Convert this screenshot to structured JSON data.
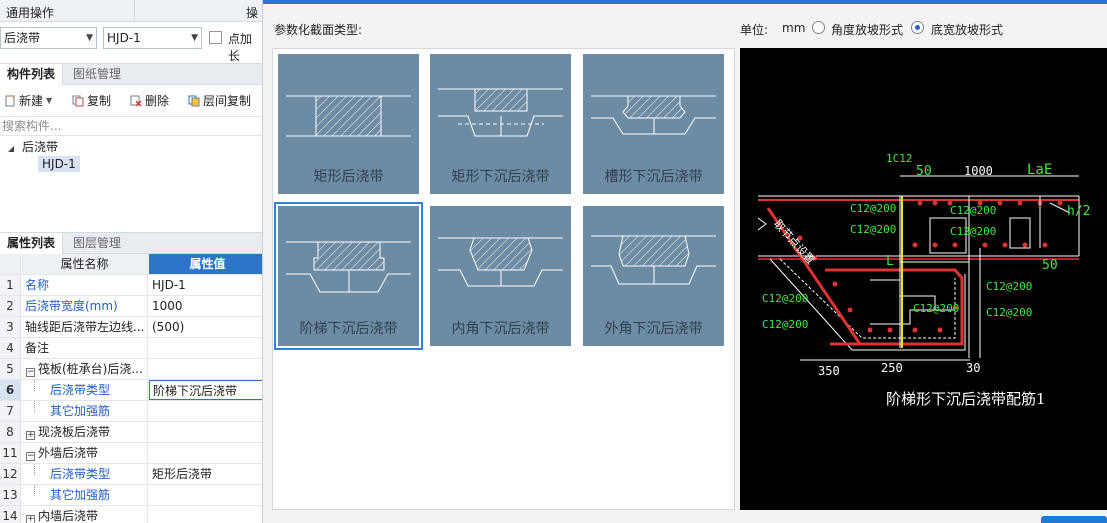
{
  "left": {
    "topbar": {
      "title": "通用操作",
      "title2": "操"
    },
    "combo1": {
      "value": "后浇带"
    },
    "combo2": {
      "value": "HJD-1"
    },
    "checkbox_label": "点加长",
    "tabs1": [
      "构件列表",
      "图纸管理"
    ],
    "toolbar": {
      "new": "新建",
      "copy": "复制",
      "delete": "删除",
      "floor_copy": "层间复制"
    },
    "search_placeholder": "搜索构件...",
    "tree": {
      "root": "后浇带",
      "child": "HJD-1"
    },
    "tabs2": [
      "属性列表",
      "图层管理"
    ],
    "grid": {
      "header": {
        "name": "属性名称",
        "value": "属性值"
      },
      "rows": [
        {
          "num": "1",
          "name": "名称",
          "value": "HJD-1",
          "blue": true
        },
        {
          "num": "2",
          "name": "后浇带宽度(mm)",
          "value": "1000",
          "blue": true
        },
        {
          "num": "3",
          "name": "轴线距后浇带左边线...",
          "value": "(500)"
        },
        {
          "num": "4",
          "name": "备注",
          "value": ""
        },
        {
          "num": "5",
          "name": "筏板(桩承台)后浇...",
          "value": "",
          "exp": "−"
        },
        {
          "num": "6",
          "name": "后浇带类型",
          "value": "阶梯下沉后浇带",
          "blue": true,
          "indent": true,
          "selected": true
        },
        {
          "num": "7",
          "name": "其它加强筋",
          "value": "",
          "blue": true,
          "indent": true
        },
        {
          "num": "8",
          "name": "现浇板后浇带",
          "value": "",
          "exp": "+"
        },
        {
          "num": "11",
          "name": "外墙后浇带",
          "value": "",
          "exp": "−"
        },
        {
          "num": "12",
          "name": "后浇带类型",
          "value": "矩形后浇带",
          "blue": true,
          "indent": true
        },
        {
          "num": "13",
          "name": "其它加强筋",
          "value": "",
          "blue": true,
          "indent": true
        },
        {
          "num": "14",
          "name": "内墙后浇带",
          "value": "",
          "exp": "+"
        }
      ]
    }
  },
  "dialog": {
    "type_label": "参数化截面类型:",
    "unit_label": "单位:",
    "unit_value": "mm",
    "radio1": "角度放坡形式",
    "radio2": "底宽放坡形式",
    "cards": [
      {
        "label": "矩形后浇带",
        "kind": "rect"
      },
      {
        "label": "矩形下沉后浇带",
        "kind": "rect-sink"
      },
      {
        "label": "槽形下沉后浇带",
        "kind": "slot-sink"
      },
      {
        "label": "阶梯下沉后浇带",
        "kind": "step-sink",
        "selected": true
      },
      {
        "label": "内角下沉后浇带",
        "kind": "inner-sink"
      },
      {
        "label": "外角下沉后浇带",
        "kind": "outer-sink"
      }
    ],
    "preview": {
      "caption": "阶梯形下沉后浇带配筋1",
      "labels": {
        "c12": "1C12",
        "d50a": "50",
        "d1000": "1000",
        "lae": "LaE",
        "h2": "h/2",
        "l": "L",
        "d50b": "50",
        "d350": "350",
        "d250": "250",
        "d30": "30",
        "bar1": "C12@200",
        "bar2": "C12@200",
        "bar3": "C12@200",
        "bar4": "C12@200",
        "bar5": "C12@200",
        "bar6": "C12@200",
        "bar7": "C12@200",
        "bar8": "C12@200",
        "bar9": "C12@200",
        "slope": "取节点设置"
      }
    }
  }
}
